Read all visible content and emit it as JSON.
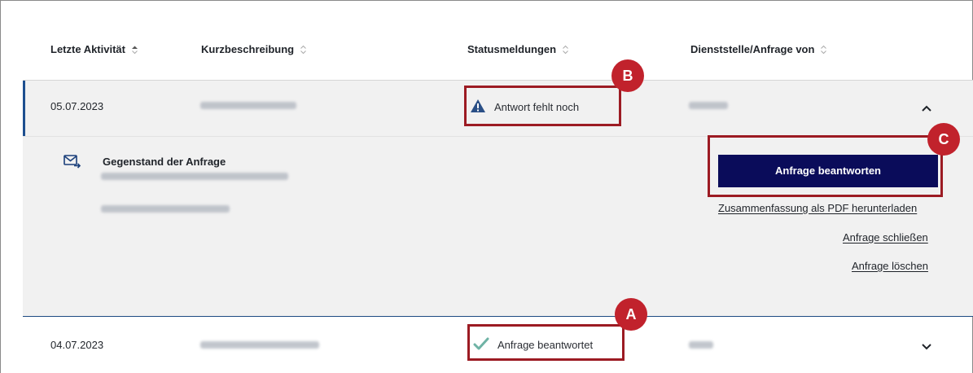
{
  "table": {
    "columns": [
      {
        "label": "Letzte Aktivität",
        "sort": "sorted"
      },
      {
        "label": "Kurzbeschreibung",
        "sort": "unsorted"
      },
      {
        "label": "Statusmeldungen",
        "sort": "unsorted"
      },
      {
        "label": "Dienststelle/Anfrage von",
        "sort": "unsorted"
      }
    ],
    "rows": [
      {
        "date": "05.07.2023",
        "status": "Antwort fehlt noch",
        "status_icon": "warning-triangle-icon",
        "expanded": true
      },
      {
        "date": "04.07.2023",
        "status": "Anfrage beantwortet",
        "status_icon": "checkmark-icon",
        "expanded": false
      }
    ]
  },
  "detail": {
    "title": "Gegenstand der Anfrage",
    "icon": "mail-forward-icon"
  },
  "actions": {
    "primary": "Anfrage beantworten",
    "download_pdf": "Zusammenfassung als PDF herunterladen",
    "close": "Anfrage schließen",
    "delete": "Anfrage löschen"
  },
  "annotations": {
    "a": "A",
    "b": "B",
    "c": "C"
  },
  "colors": {
    "primary_button": "#0a0c5a",
    "annotation": "#c1222c",
    "row_accent": "#1d4f8f",
    "warning_icon": "#2a4f86",
    "check_icon": "#6fb3a5"
  }
}
